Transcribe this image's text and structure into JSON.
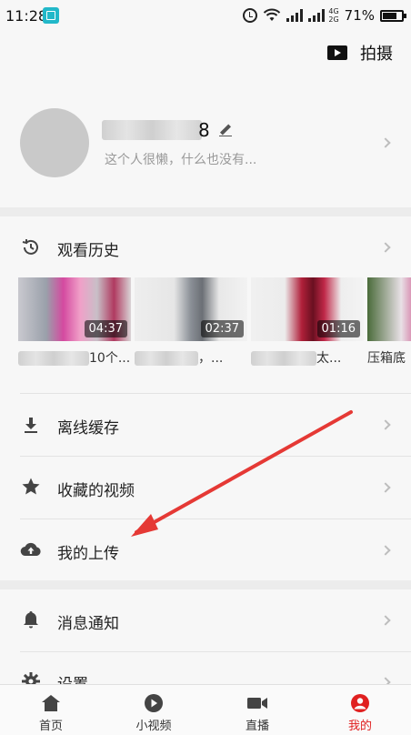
{
  "status_bar": {
    "time": "11:28",
    "network": "4G\n2G",
    "battery": "71%"
  },
  "header": {
    "shoot_label": "拍摄"
  },
  "profile": {
    "username_visible": "8",
    "signature": "这个人很懒，什么也没有..."
  },
  "history": {
    "label": "观看历史",
    "videos": [
      {
        "title_visible": "10个...",
        "duration": "04:37"
      },
      {
        "title_visible": "，...",
        "duration": "02:37"
      },
      {
        "title_visible": "太...",
        "duration": "01:16"
      },
      {
        "title_visible": "压箱底",
        "duration": ""
      }
    ]
  },
  "menu": {
    "offline_cache": "离线缓存",
    "favorites": "收藏的视频",
    "my_uploads": "我的上传",
    "notifications": "消息通知",
    "settings": "设置"
  },
  "bottom_nav": {
    "items": [
      {
        "label": "首页",
        "icon": "home-icon"
      },
      {
        "label": "小视频",
        "icon": "play-circle-icon"
      },
      {
        "label": "直播",
        "icon": "video-camera-icon"
      },
      {
        "label": "我的",
        "icon": "profile-icon"
      }
    ],
    "active_color": "#e02020"
  },
  "colors": {
    "annotation_arrow": "#e53935",
    "background": "#f7f7f7"
  }
}
